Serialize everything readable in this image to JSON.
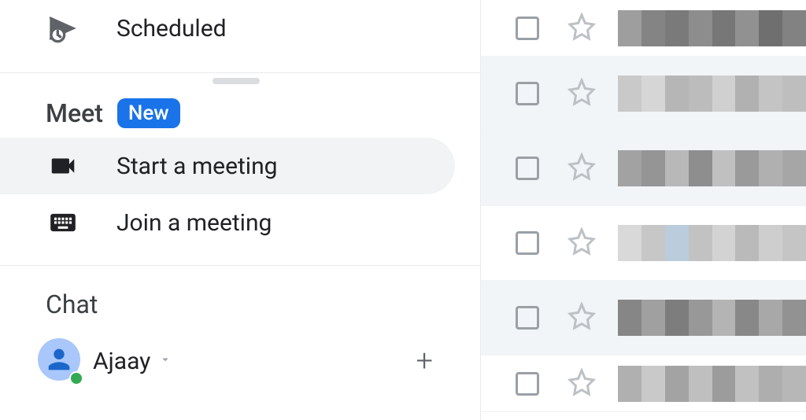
{
  "sidebar": {
    "scheduled_label": "Scheduled",
    "meet": {
      "title": "Meet",
      "badge": "New",
      "start_label": "Start a meeting",
      "join_label": "Join a meeting"
    },
    "chat": {
      "title": "Chat",
      "user_name": "Ajaay"
    }
  },
  "mail_rows": 6
}
